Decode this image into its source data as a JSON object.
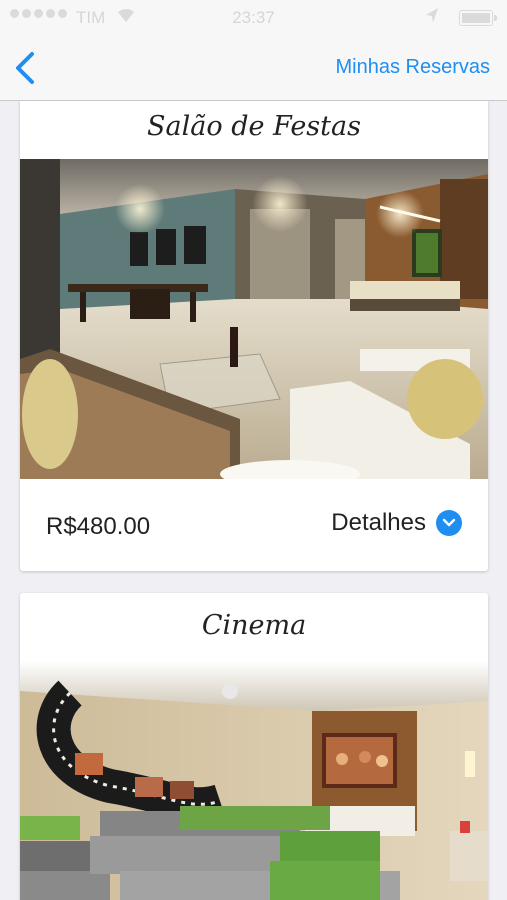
{
  "status_bar": {
    "carrier": "TIM",
    "time": "23:37"
  },
  "nav": {
    "back_icon": "chevron-left-icon",
    "right_link": "Minhas Reservas"
  },
  "cards": [
    {
      "title": "Salão de Festas",
      "price": "R$480.00",
      "details_label": "Detalhes"
    },
    {
      "title": "Cinema"
    }
  ],
  "colors": {
    "accent": "#1f8ef1",
    "background": "#efeff4"
  }
}
